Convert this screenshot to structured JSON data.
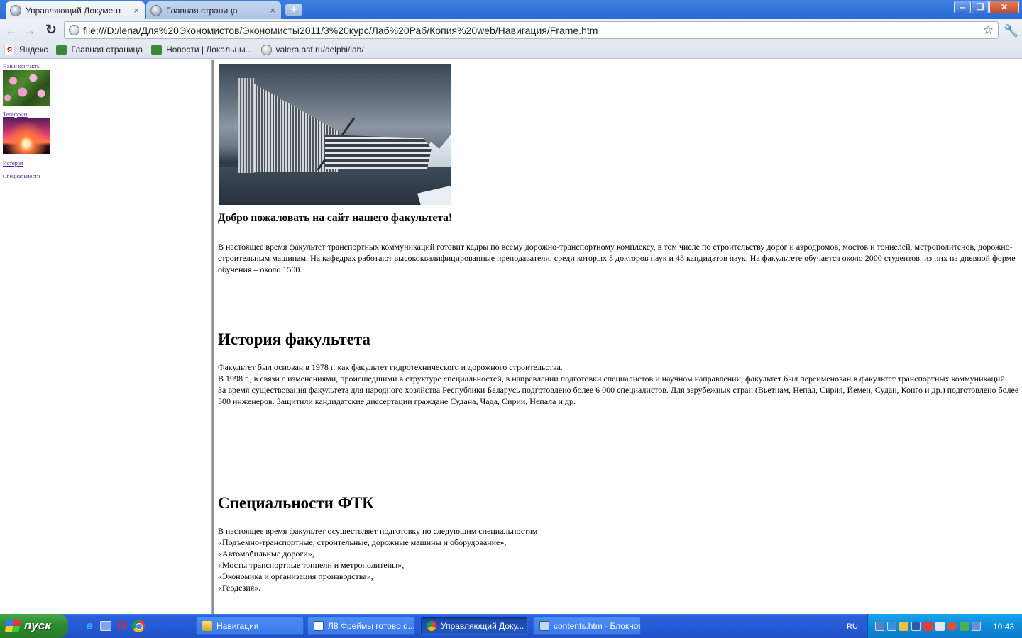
{
  "browser": {
    "tabs": [
      {
        "title": "Управляющий Документ",
        "active": true
      },
      {
        "title": "Главная страница",
        "active": false
      }
    ],
    "new_tab_symbol": "+",
    "close_symbol": "×",
    "window_controls": {
      "minimize": "–",
      "maximize": "❐",
      "close": "✕"
    },
    "url": "file:///D:/lena/Для%20Экономистов/Экономисты2011/3%20курс/Лаб%20Раб/Копия%20web/Навигация/Frame.htm",
    "bookmarks": [
      {
        "label": "Яндекс",
        "icon": "yandex-icon",
        "glyph": "Я"
      },
      {
        "label": "Главная страница",
        "icon": "green-page-icon",
        "glyph": ""
      },
      {
        "label": "Новости | Локальны...",
        "icon": "green-page-icon",
        "glyph": ""
      },
      {
        "label": "valera.asf.ru/delphi/lab/",
        "icon": "globe-icon",
        "glyph": ""
      }
    ]
  },
  "nav_frame": {
    "links": [
      {
        "label": "Наши контакты",
        "image": "water-lilies"
      },
      {
        "label": "Телефоны",
        "image": "sunset"
      },
      {
        "label": "История"
      },
      {
        "label": "Специальности"
      }
    ]
  },
  "content": {
    "welcome": "Добро пожаловать на сайт нашего факультета!",
    "intro": "В настоящее время факультет транспортных коммуникаций готовит кадры по всему дорожно-транспортному комплексу, в том числе по строительству дорог и аэродромов, мостов и тоннелей, метрополитенов, дорожно-строительным машинам. На кафедрах работают высококвалифицированные преподаватели, среди которых 8 докторов наук и 48 кандидатов наук. На факультете обучается около 2000 студентов, из них на дневной форме обучения – около 1500.",
    "history_title": "История факультета",
    "history_lines": [
      "Факультет был основан в 1978 г. как факультет гидротехнического и дорожного строительства.",
      "В 1998 г., в связи с изменениями, происшедшими в структуре специальностей, в направлении подготовки специалистов и научном направлении, факультет был переименован в факультет транспортных коммуникаций.",
      "За время существования факультета для народного хозяйства Республики Беларусь подготовлено более 6 000 специалистов. Для зарубежных стран (Вьетнам, Непал, Сирия, Йемен, Судан, Конго и др.) подготовлено более 300 инженеров. Защитили кандидатские диссертации граждане Судана, Чада, Сирии, Непала и др."
    ],
    "specialties_title": "Специальности ФТК",
    "specialties_lines": [
      "В настоящее время факультет осуществляет подготовку по следующим специальностям",
      "«Подъемно-транспортные, строительные, дорожные машины и оборудование»,",
      "«Автомобильные дороги»,",
      "«Мосты транспортные тоннели и метрополитены»,",
      "«Экономика и организация производства»,",
      "«Геодезия»."
    ]
  },
  "taskbar": {
    "start_label": "пуск",
    "tasks": [
      {
        "label": "Навигация",
        "icon": "folder-icon",
        "active": false
      },
      {
        "label": "Л8 Фреймы готово.d...",
        "icon": "word-icon",
        "active": false
      },
      {
        "label": "Управляющий Доку...",
        "icon": "chrome-icon",
        "active": true
      },
      {
        "label": "contents.htm - Блокнот",
        "icon": "notepad-icon",
        "active": false
      }
    ],
    "language": "RU",
    "clock": "10:43"
  }
}
